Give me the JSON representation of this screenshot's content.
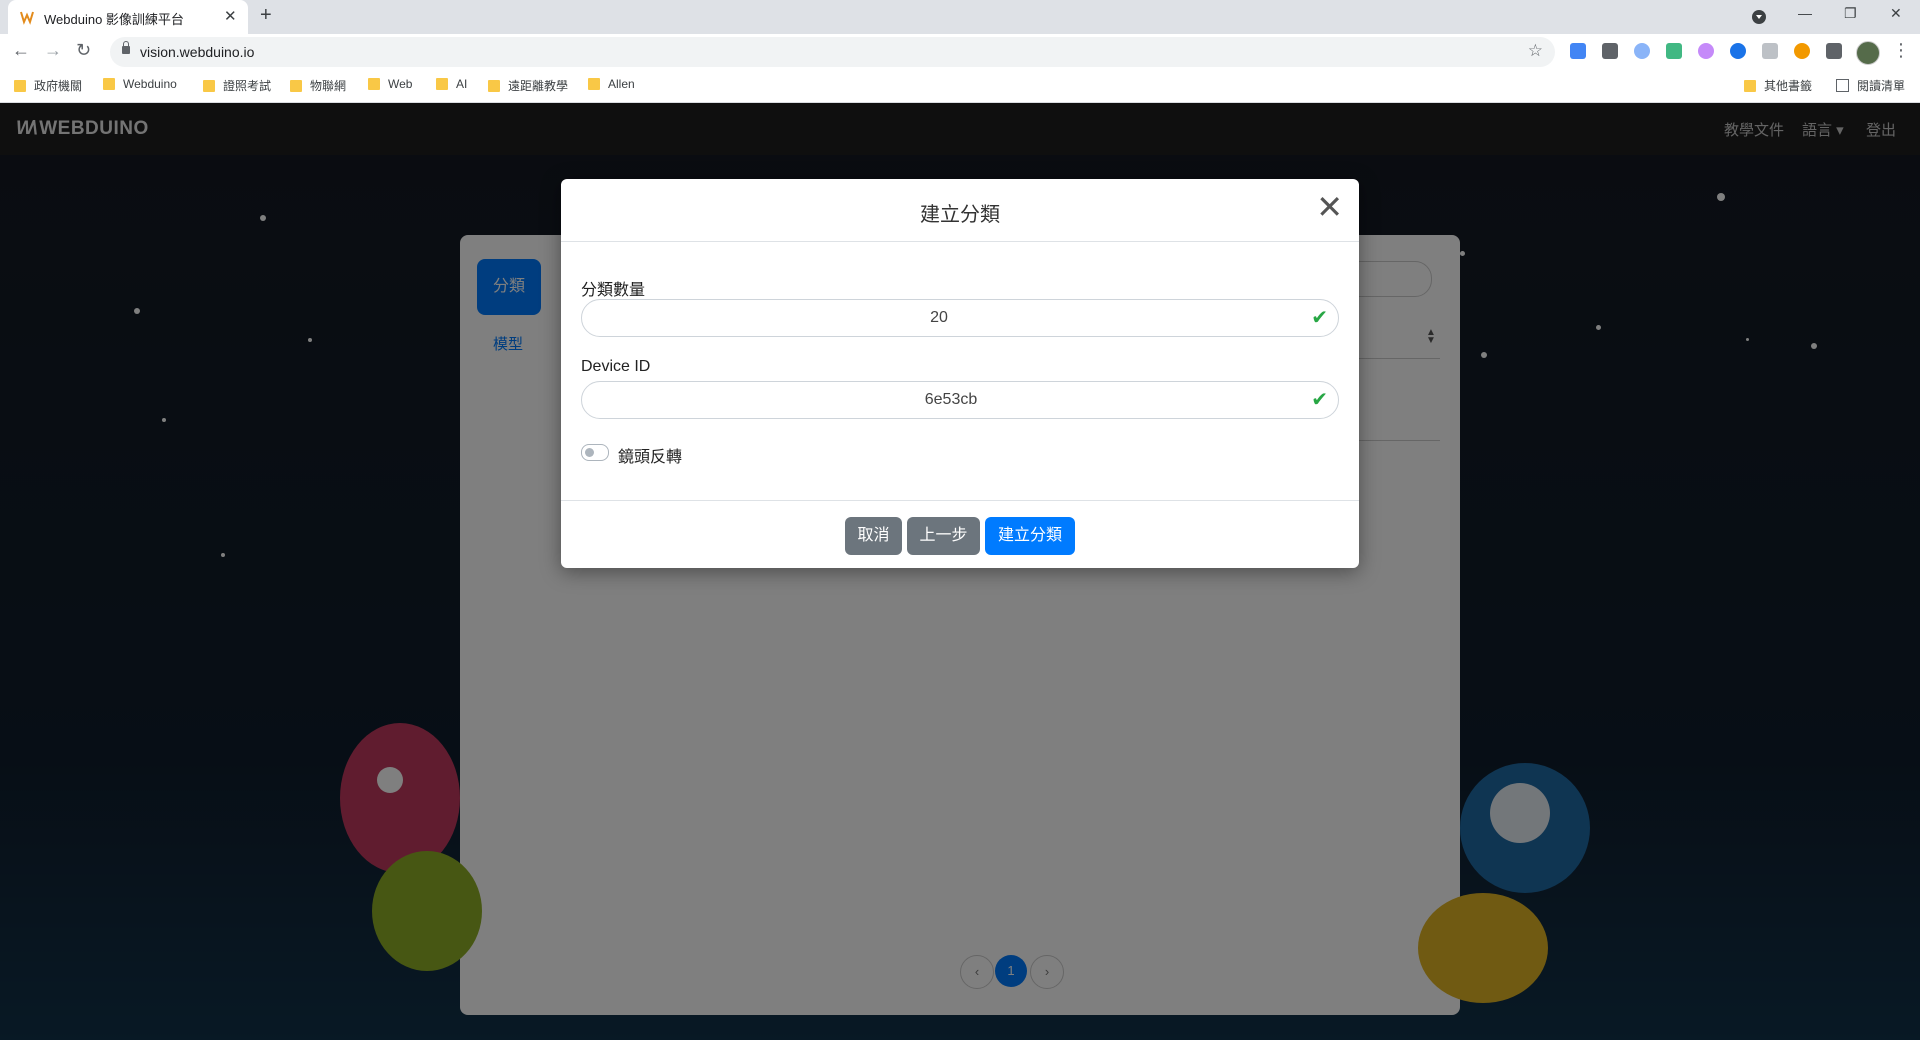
{
  "browser": {
    "tab_title": "Webduino 影像訓練平台",
    "tab_close": "✕",
    "new_tab": "+",
    "url": "vision.webduino.io",
    "window_controls": [
      "—",
      "❐",
      "✕"
    ],
    "nav": {
      "back": "←",
      "forward": "→",
      "reload": "↻"
    },
    "star": "☆",
    "menu": "⋮",
    "bookmarks": [
      "政府機關",
      "Webduino",
      "證照考試",
      "物聯網",
      "Web",
      "AI",
      "遠距離教學",
      "Allen"
    ],
    "bookmarks_right": {
      "other": "其他書籤",
      "reading_list": "閱讀清單"
    }
  },
  "app": {
    "brand": "WEBDUINO",
    "brand_mark": "W\\",
    "nav": {
      "docs": "教學文件",
      "language": "語言 ▾",
      "logout": "登出"
    },
    "card": {
      "sidebar_active": "分類",
      "sidebar_link": "模型",
      "pager_prev": "‹",
      "pager_page": "1",
      "pager_next": "›"
    }
  },
  "modal": {
    "title": "建立分類",
    "close": "✕",
    "class_count_label": "分類數量",
    "class_count_value": "20",
    "device_id_label": "Device ID",
    "device_id_value": "6e53cb",
    "valid_mark": "✔",
    "mirror_label": "鏡頭反轉",
    "mirror_on": false,
    "buttons": {
      "cancel": "取消",
      "back": "上一步",
      "create": "建立分類"
    }
  },
  "colors": {
    "primary": "#007bff",
    "secondary": "#6c757d",
    "valid": "#28a745"
  }
}
